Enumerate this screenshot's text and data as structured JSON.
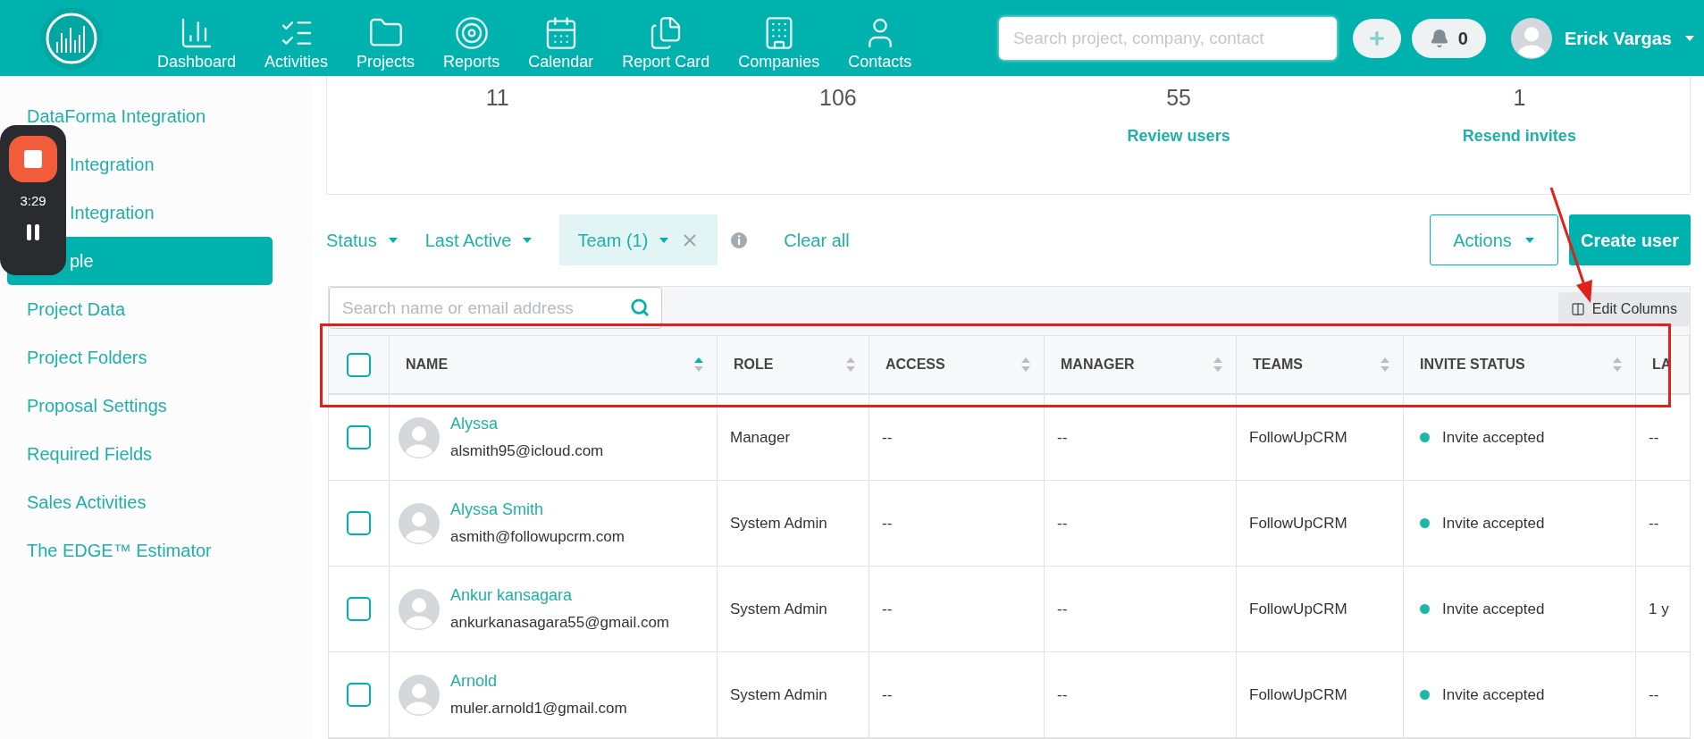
{
  "nav": {
    "items": [
      {
        "label": "Dashboard"
      },
      {
        "label": "Activities"
      },
      {
        "label": "Projects"
      },
      {
        "label": "Reports"
      },
      {
        "label": "Calendar"
      },
      {
        "label": "Report Card"
      },
      {
        "label": "Companies"
      },
      {
        "label": "Contacts"
      }
    ],
    "search": {
      "placeholder": "Search project, company, contact"
    },
    "notifications": "0",
    "user": "Erick Vargas"
  },
  "sidebar": {
    "items": [
      {
        "label": "DataForma Integration",
        "selected": false,
        "covered": false
      },
      {
        "label": "Integration",
        "selected": false,
        "covered": true
      },
      {
        "label": "Integration",
        "selected": false,
        "covered": true
      },
      {
        "label": "ple",
        "selected": true,
        "covered": true
      },
      {
        "label": "Project Data",
        "selected": false,
        "covered": false
      },
      {
        "label": "Project Folders",
        "selected": false,
        "covered": false
      },
      {
        "label": "Proposal Settings",
        "selected": false,
        "covered": false
      },
      {
        "label": "Required Fields",
        "selected": false,
        "covered": false
      },
      {
        "label": "Sales Activities",
        "selected": false,
        "covered": false
      },
      {
        "label": "The EDGE™ Estimator",
        "selected": false,
        "covered": false
      }
    ]
  },
  "recorder": {
    "time": "3:29"
  },
  "stats": [
    {
      "value": "11"
    },
    {
      "value": "106"
    },
    {
      "value": "55",
      "link": "Review users"
    },
    {
      "value": "1",
      "link": "Resend invites"
    }
  ],
  "filters": [
    {
      "label": "Status",
      "kind": "dropdown"
    },
    {
      "label": "Last Active",
      "kind": "dropdown"
    },
    {
      "label": "Team (1)",
      "kind": "chip"
    }
  ],
  "clear_all": "Clear all",
  "actions": "Actions",
  "create_user": "Create user",
  "table": {
    "search": {
      "placeholder": "Search name or email address"
    },
    "edit_columns": "Edit Columns",
    "select_all": {
      "checked": false
    },
    "columns": [
      {
        "label": "NAME",
        "sorted": true
      },
      {
        "label": "ROLE",
        "sorted": false
      },
      {
        "label": "ACCESS",
        "sorted": false
      },
      {
        "label": "MANAGER",
        "sorted": false
      },
      {
        "label": "TEAMS",
        "sorted": false
      },
      {
        "label": "INVITE STATUS",
        "sorted": false
      },
      {
        "label": "LA"
      }
    ],
    "rows": [
      {
        "checked": false,
        "name": "Alyssa",
        "email": "alsmith95@icloud.com",
        "role": "Manager",
        "access": "--",
        "manager": "--",
        "teams": "FollowUpCRM",
        "status": "Invite accepted",
        "column_8": "--"
      },
      {
        "checked": false,
        "name": "Alyssa Smith",
        "email": "asmith@followupcrm.com",
        "role": "System Admin",
        "access": "--",
        "manager": "--",
        "teams": "FollowUpCRM",
        "status": "Invite accepted",
        "column_8": "--"
      },
      {
        "checked": false,
        "name": "Ankur kansagara",
        "email": "ankurkanasagara55@gmail.com",
        "role": "System Admin",
        "access": "--",
        "manager": "--",
        "teams": "FollowUpCRM",
        "status": "Invite accepted",
        "column_8": "1 y"
      },
      {
        "checked": false,
        "name": "Arnold",
        "email": "muler.arnold1@gmail.com",
        "role": "System Admin",
        "access": "--",
        "manager": "--",
        "teams": "FollowUpCRM",
        "status": "Invite accepted",
        "column_8": "--"
      }
    ]
  }
}
